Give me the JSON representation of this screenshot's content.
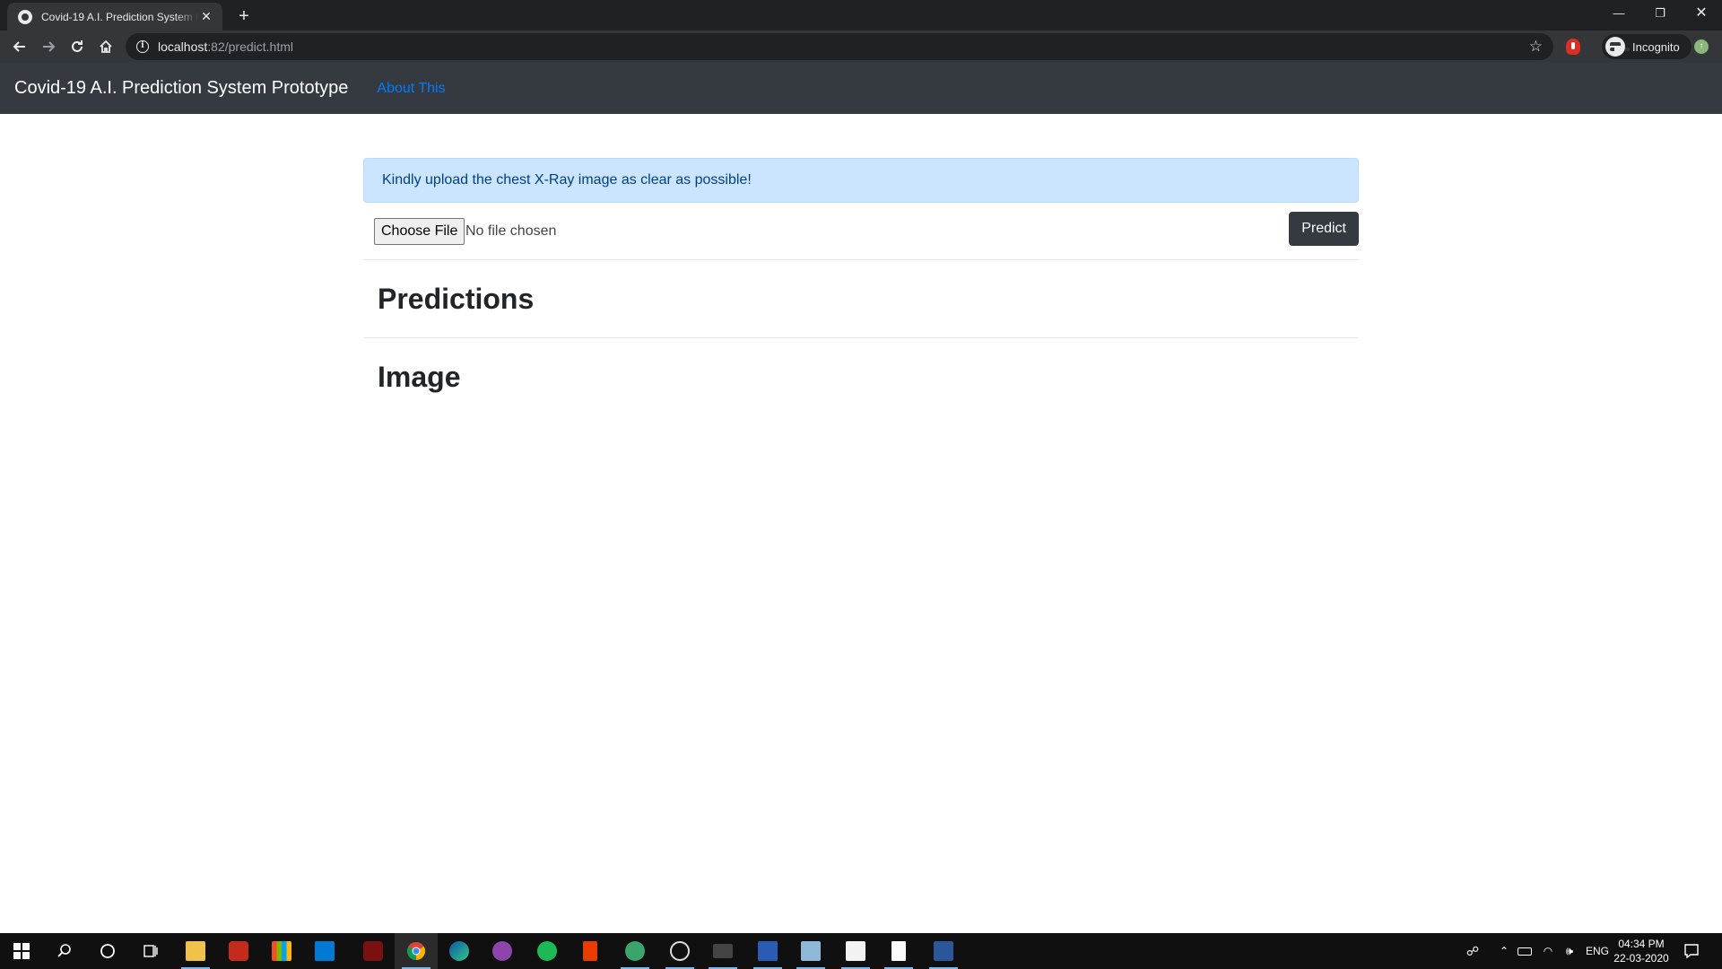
{
  "browser": {
    "tab_title": "Covid-19 A.I. Prediction System Prototype",
    "tab_close_glyph": "✕",
    "new_tab_glyph": "+",
    "minimize_glyph": "—",
    "restore_glyph": "❐",
    "close_glyph": "✕",
    "url_host": "localhost",
    "url_rest": ":82/predict.html",
    "incognito_label": "Incognito"
  },
  "navbar": {
    "brand": "Covid-19 A.I. Prediction System Prototype",
    "about_link": "About This"
  },
  "main": {
    "alert_text": "Kindly upload the chest X-Ray image as clear as possible!",
    "choose_file_label": "Choose File",
    "file_status": "No file chosen",
    "predict_label": "Predict",
    "predictions_heading": "Predictions",
    "image_heading": "Image"
  },
  "taskbar": {
    "language": "ENG",
    "time": "04:34 PM",
    "date": "22-03-2020"
  },
  "colors": {
    "navbar_bg": "#343a40",
    "link": "#007bff",
    "alert_bg": "#cce5ff",
    "alert_text": "#004085",
    "button_dark": "#343a40"
  }
}
